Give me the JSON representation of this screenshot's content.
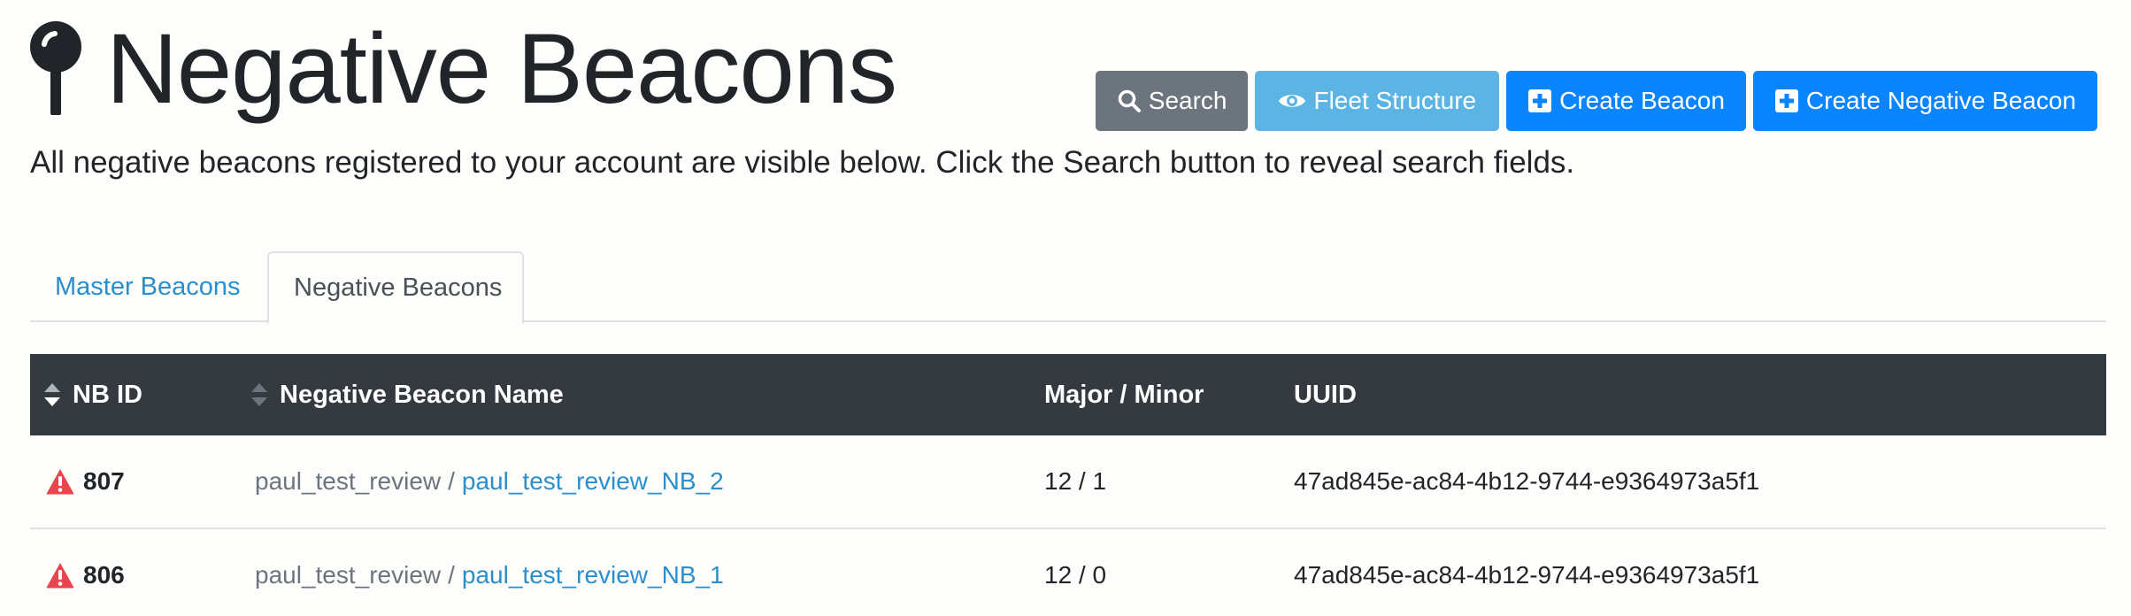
{
  "header": {
    "icon": "map-pin-icon",
    "title": "Negative Beacons",
    "subtitle": "All negative beacons registered to your account are visible below. Click the Search button to reveal search fields."
  },
  "toolbar": {
    "search": {
      "label": "Search",
      "icon": "search-icon",
      "color": "#6c757d"
    },
    "fleet": {
      "label": "Fleet Structure",
      "icon": "eye-icon",
      "color": "#5bb4e4"
    },
    "create_beacon": {
      "label": "Create Beacon",
      "icon": "plus-square-icon",
      "color": "#0a84ff"
    },
    "create_negative": {
      "label": "Create Negative Beacon",
      "icon": "plus-square-icon",
      "color": "#0a84ff"
    }
  },
  "tabs": [
    {
      "label": "Master Beacons",
      "active": false
    },
    {
      "label": "Negative Beacons",
      "active": true
    }
  ],
  "table": {
    "columns": [
      {
        "label": "NB ID",
        "sortable": true
      },
      {
        "label": "Negative Beacon Name",
        "sortable": true
      },
      {
        "label": "Major / Minor",
        "sortable": false
      },
      {
        "label": "UUID",
        "sortable": false
      }
    ],
    "rows": [
      {
        "status_icon": "warning-icon",
        "id": "807",
        "owner": "paul_test_review",
        "separator": "/",
        "name": "paul_test_review_NB_2",
        "major_minor": "12 / 1",
        "uuid": "47ad845e-ac84-4b12-9744-e9364973a5f1"
      },
      {
        "status_icon": "warning-icon",
        "id": "806",
        "owner": "paul_test_review",
        "separator": "/",
        "name": "paul_test_review_NB_1",
        "major_minor": "12 / 0",
        "uuid": "47ad845e-ac84-4b12-9744-e9364973a5f1"
      }
    ]
  },
  "colors": {
    "link": "#2a8fcc",
    "table_header": "#343a40",
    "warning": "#e8454f"
  }
}
